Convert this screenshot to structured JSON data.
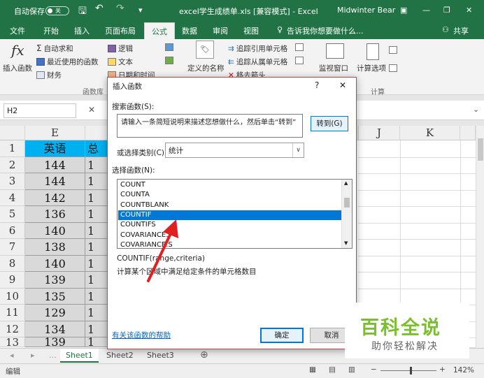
{
  "titlebar": {
    "autosave_label": "自动保存",
    "autosave_state": "关",
    "title": "excel学生成绩单.xls [兼容模式] - Excel",
    "user": "Midwinter Bear",
    "qat_more": "▾"
  },
  "tabs": [
    "文件",
    "开始",
    "插入",
    "页面布局",
    "公式",
    "数据",
    "审阅",
    "视图"
  ],
  "tell_me": "告诉我你想要做什么...",
  "share": "共享",
  "ribbon": {
    "insert_function": "插入函数",
    "autosum": "自动求和",
    "recent": "最近使用的函数",
    "financial": "财务",
    "logical": "逻辑",
    "text": "文本",
    "datetime": "日期和时间",
    "define_name": "定义的名称",
    "trace_precedents": "追踪引用单元格",
    "trace_dependents": "追踪从属单元格",
    "remove_arrows": "移去箭头",
    "watch": "监视窗口",
    "calc_options": "计算选项",
    "group_library": "函数库",
    "group_calc": "计算"
  },
  "formula_bar": {
    "name_box": "H2",
    "cancel": "✕"
  },
  "grid": {
    "col_e": "E",
    "col_j": "J",
    "col_k": "K",
    "header_cell": "英语",
    "header_next": "总",
    "rows": [
      "1",
      "2",
      "3",
      "4",
      "5",
      "6",
      "7",
      "8",
      "9",
      "10",
      "11",
      "12",
      "13"
    ],
    "english": [
      "144",
      "144",
      "142",
      "136",
      "140",
      "138",
      "140",
      "139",
      "135",
      "129",
      "134",
      "139"
    ],
    "next": [
      "1",
      "1",
      "1",
      "1",
      "1",
      "1",
      "1",
      "1",
      "1",
      "1",
      "1",
      "1"
    ]
  },
  "sheets": [
    "Sheet1",
    "Sheet2",
    "Sheet3"
  ],
  "status": {
    "mode": "编辑",
    "zoom": "142%"
  },
  "dialog": {
    "title": "插入函数",
    "help": "?",
    "close": "✕",
    "search_label": "搜索函数(S):",
    "search_text": "请输入一条简短说明来描述您想做什么，然后单击“转到”",
    "go": "转到(G)",
    "category_label": "或选择类别(C):",
    "category_value": "统计",
    "select_label": "选择函数(N):",
    "functions": [
      "COUNT",
      "COUNTA",
      "COUNTBLANK",
      "COUNTIF",
      "COUNTIFS",
      "COVARIANCE.P",
      "COVARIANCE.S"
    ],
    "selected": "COUNTIF",
    "signature": "COUNTIF(range,criteria)",
    "description": "计算某个区域中满足给定条件的单元格数目",
    "help_link": "有关该函数的帮助",
    "ok": "确定",
    "cancel": "取消"
  },
  "watermark": {
    "brand": "百科全说",
    "tagline": "助你轻松解决"
  },
  "colors": {
    "excel_green": "#217346",
    "selection_blue": "#0078d7",
    "arrow_red": "#e02020",
    "header_cyan": "#00b0f0"
  }
}
